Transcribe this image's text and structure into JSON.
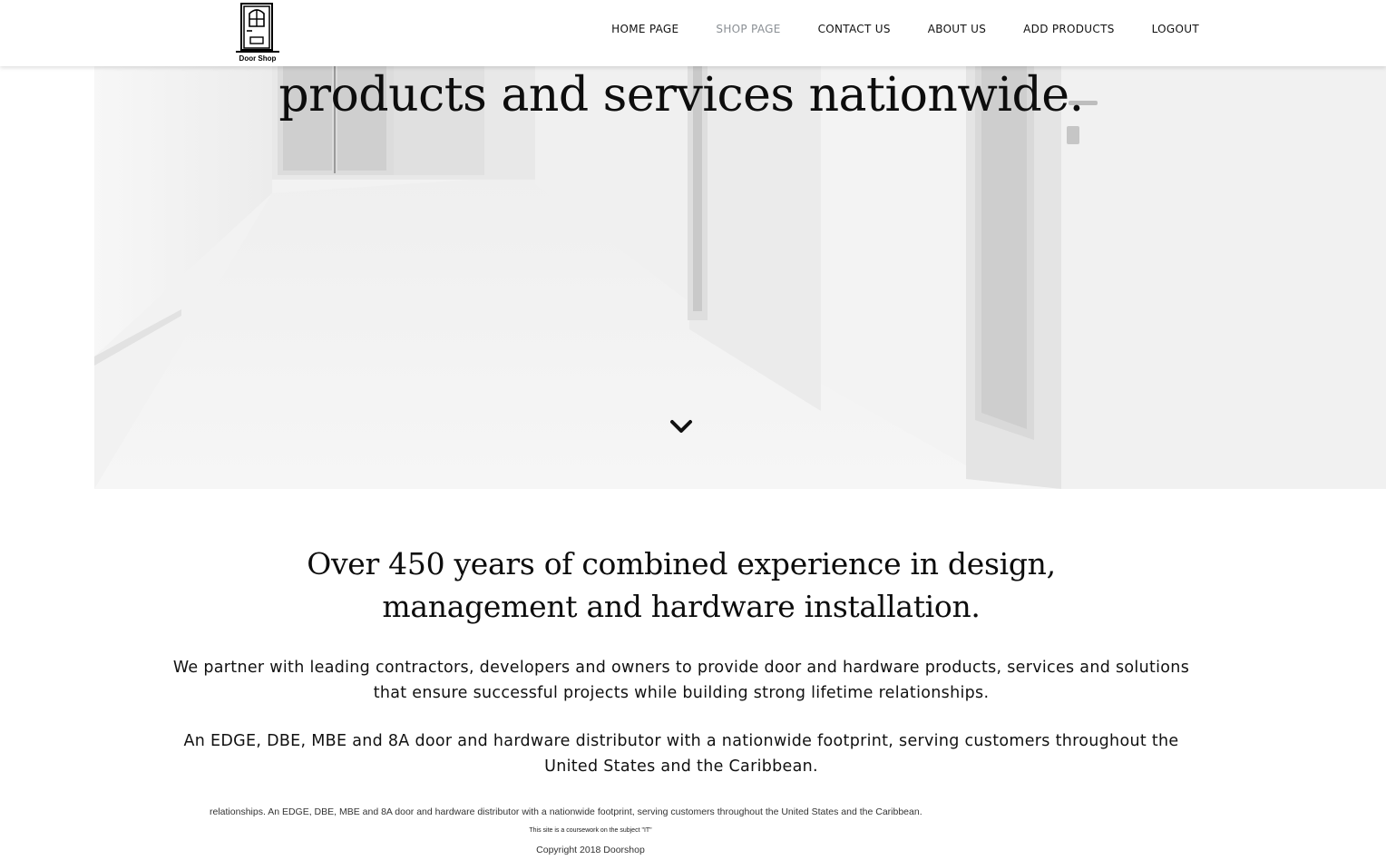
{
  "brand": {
    "logo_text": "Door Shop"
  },
  "nav": {
    "items": [
      {
        "label": "HOME PAGE"
      },
      {
        "label": "SHOP PAGE"
      },
      {
        "label": "CONTACT US"
      },
      {
        "label": "ABOUT US"
      },
      {
        "label": "ADD PRODUCTS"
      },
      {
        "label": "LOGOUT"
      }
    ],
    "active_index": 1
  },
  "hero": {
    "title": "products and services nationwide.",
    "scroll_icon": "chevron-down-icon"
  },
  "content": {
    "headline_line1": "Over 450 years of combined experience in design,",
    "headline_line2": "management and hardware installation.",
    "paragraph1": "We partner with leading contractors, developers and owners to provide door and hardware products, services and solutions that ensure successful projects while building strong lifetime relationships.",
    "paragraph2": "An EDGE, DBE, MBE and 8A door and hardware distributor with a nationwide footprint, serving customers throughout the United States and the Caribbean."
  },
  "footer": {
    "text": "relationships. An EDGE, DBE, MBE and 8A door and hardware distributor with a nationwide footprint, serving customers throughout the United States and the Caribbean.",
    "note": "This site is a coursework on the subject \"IT\"",
    "copyright": "Copyright 2018 Doorshop"
  },
  "colors": {
    "nav_active": "#8a8f94",
    "text": "#111111",
    "hero_bg": "#f3f3f3"
  }
}
